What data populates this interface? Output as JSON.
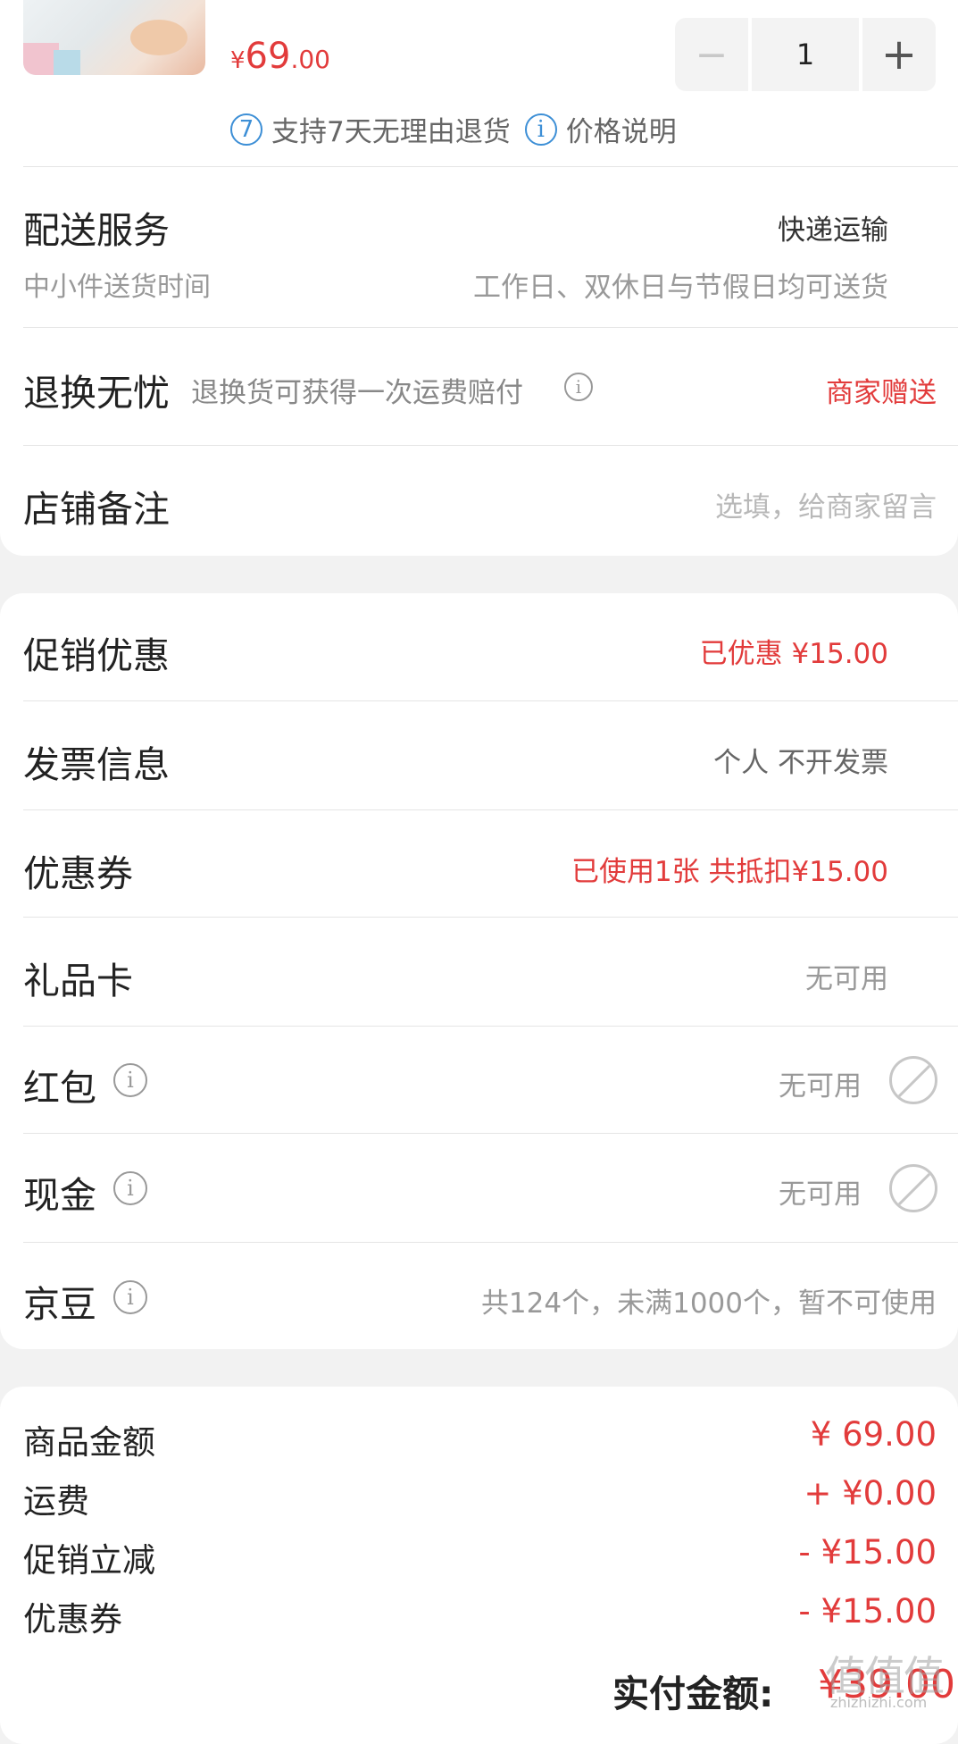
{
  "product": {
    "price_currency": "¥",
    "price_int": "69",
    "price_dec": ".00",
    "quantity": "1",
    "minus": "−",
    "plus": "+",
    "tag1_num": "7",
    "tag1_text": "支持7天无理由退货",
    "tag2_icon": "i",
    "tag2_text": "价格说明"
  },
  "delivery": {
    "title": "配送服务",
    "method": "快递运输",
    "sub_label": "中小件送货时间",
    "sub_value": "工作日、双休日与节假日均可送货"
  },
  "return_service": {
    "title": "退换无忧",
    "desc": "退换货可获得一次运费赔付",
    "value": "商家赠送"
  },
  "store_note": {
    "title": "店铺备注",
    "placeholder": "选填，给商家留言"
  },
  "rows": {
    "promo_label": "促销优惠",
    "promo_value": "已优惠 ¥15.00",
    "invoice_label": "发票信息",
    "invoice_value": "个人 不开发票",
    "coupon_label": "优惠券",
    "coupon_value": "已使用1张 共抵扣¥15.00",
    "giftcard_label": "礼品卡",
    "giftcard_value": "无可用",
    "redpacket_label": "红包",
    "redpacket_value": "无可用",
    "cash_label": "现金",
    "cash_value": "无可用",
    "jingdou_label": "京豆",
    "jingdou_value": "共124个，未满1000个，暂不可使用"
  },
  "summary": {
    "goods_label": "商品金额",
    "goods_value": "¥ 69.00",
    "shipping_label": "运费",
    "shipping_value": "+ ¥0.00",
    "promo_label": "促销立减",
    "promo_value": "- ¥15.00",
    "coupon_label": "优惠券",
    "coupon_value": "- ¥15.00",
    "total_label": "实付金额:",
    "total_value": "¥39.00"
  },
  "watermark": {
    "text": "值值值",
    "sub": "zhizhizhi.com"
  },
  "colors": {
    "accent_red": "#e23b3b",
    "info_blue": "#3d8fd6"
  }
}
